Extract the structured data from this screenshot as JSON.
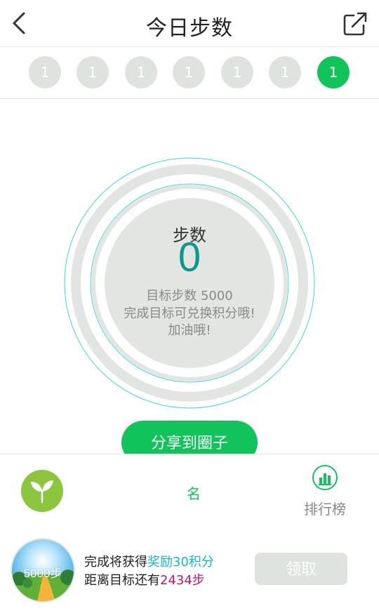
{
  "header": {
    "title": "今日步数",
    "back_icon": "chevron-left-icon",
    "share_icon": "external-share-icon"
  },
  "days": [
    "1",
    "1",
    "1",
    "1",
    "1",
    "1",
    "1"
  ],
  "colors": {
    "accent": "#10c35a",
    "inactive": "#dfe3df",
    "step_value": "#0a9a8a",
    "reward_highlight": "#15b8c4",
    "distance_highlight": "#c0186c"
  },
  "ring": {
    "steps_label": "步数",
    "steps_value": "0",
    "goal_text": "目标步数 5000",
    "hint_text": "完成目标可兑换积分哦!",
    "cheer_text": "加油哦!"
  },
  "share_button": {
    "label": "分享到圈子"
  },
  "toolbar": {
    "rank_text": "名",
    "rank_button_label": "排行榜"
  },
  "reward": {
    "image_label": "5000步",
    "line1_prefix": "完成将获得",
    "line1_highlight": "奖励30积分",
    "line2_prefix": "距离目标还有",
    "line2_highlight": "2434步",
    "claim_label": "领取"
  }
}
